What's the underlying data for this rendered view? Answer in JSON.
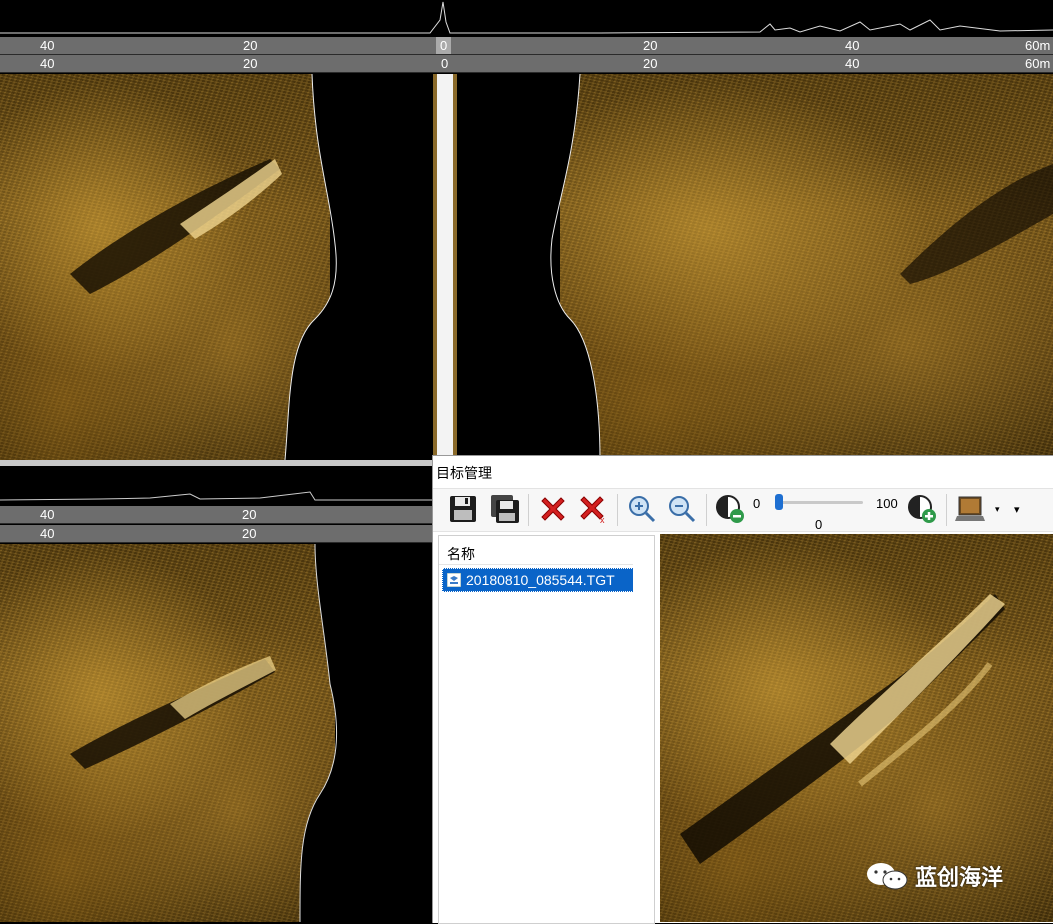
{
  "top_ruler": {
    "row1": [
      "40",
      "20",
      "0",
      "20",
      "40",
      "60m"
    ],
    "row2": [
      "40",
      "20",
      "0",
      "20",
      "40",
      "60m"
    ]
  },
  "bottom_ruler": {
    "row1": [
      "40",
      "20"
    ],
    "row2": [
      "40",
      "20"
    ]
  },
  "target_panel": {
    "title": "目标管理",
    "toolbar": {
      "save_icon": "save-icon",
      "save_all_icon": "save-all-icon",
      "delete_icon": "delete-icon",
      "delete_all_icon": "delete-all-icon",
      "zoom_in_icon": "zoom-in-icon",
      "zoom_out_icon": "zoom-out-icon",
      "contrast_min_label": "0",
      "contrast_value": "0",
      "contrast_max_label": "100",
      "contrast_level": 0
    },
    "list_header": "名称",
    "files": [
      "20180810_085544.TGT"
    ]
  },
  "watermark": "蓝创海洋",
  "colors": {
    "sonar_gold": "#b8862a",
    "ruler_gray": "#6d6d6d",
    "selection_blue": "#0a64c8"
  }
}
